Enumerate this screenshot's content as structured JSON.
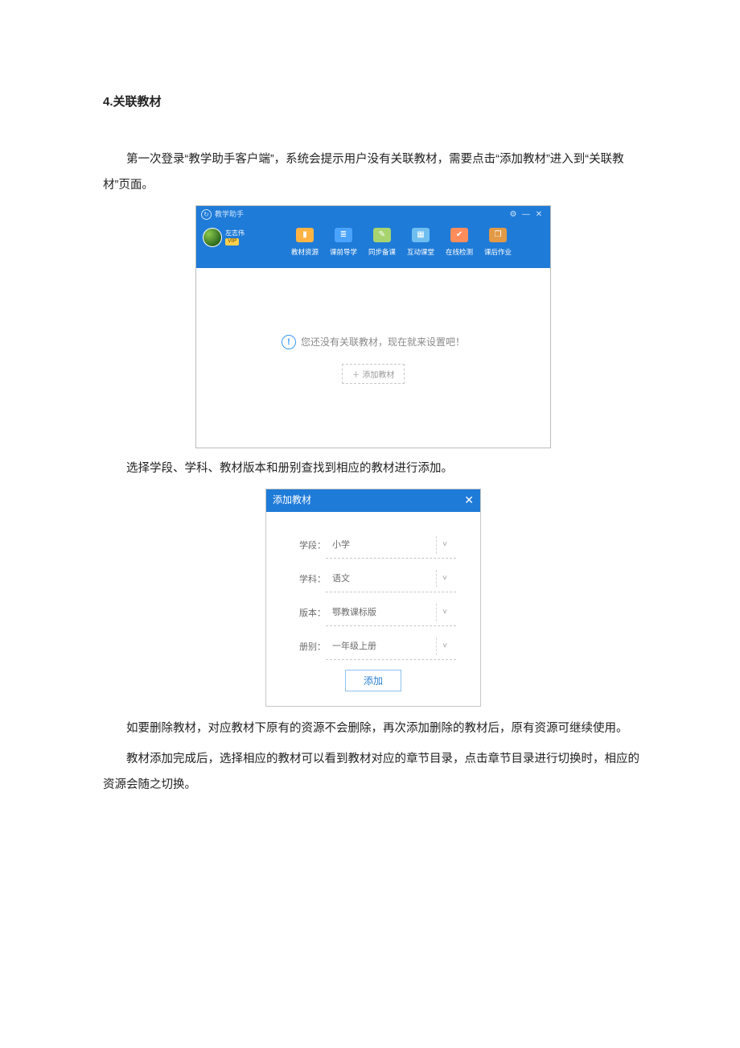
{
  "doc": {
    "heading": "4.关联教材",
    "p1": "第一次登录“教学助手客户端”，系统会提示用户没有关联教材，需要点击“添加教材”进入到“关联教材”页面。",
    "p2": "选择学段、学科、教材版本和册别查找到相应的教材进行添加。",
    "p3": "如要删除教材，对应教材下原有的资源不会删除，再次添加删除的教材后，原有资源可继续使用。",
    "p4": "教材添加完成后，选择相应的教材可以看到教材对应的章节目录，点击章节目录进行切换时，相应的资源会随之切换。"
  },
  "shot1": {
    "app_title": "教学助手",
    "user_name": "左志伟",
    "user_badge": "VIP",
    "nav": [
      "教材资源",
      "课前导学",
      "同步备课",
      "互动课堂",
      "在线检测",
      "课后作业"
    ],
    "empty_msg": "您还没有关联教材，现在就来设置吧！",
    "add_label": "＋ 添加教材",
    "win": {
      "settings": "⚙",
      "min": "—",
      "close": "✕"
    }
  },
  "shot2": {
    "title": "添加教材",
    "close": "✕",
    "fields": {
      "stage_label": "学段：",
      "stage_val": "小学",
      "subject_label": "学科：",
      "subject_val": "语文",
      "version_label": "版本：",
      "version_val": "鄂教课标版",
      "volume_label": "册别：",
      "volume_val": "一年级上册"
    },
    "add_label": "添加"
  }
}
